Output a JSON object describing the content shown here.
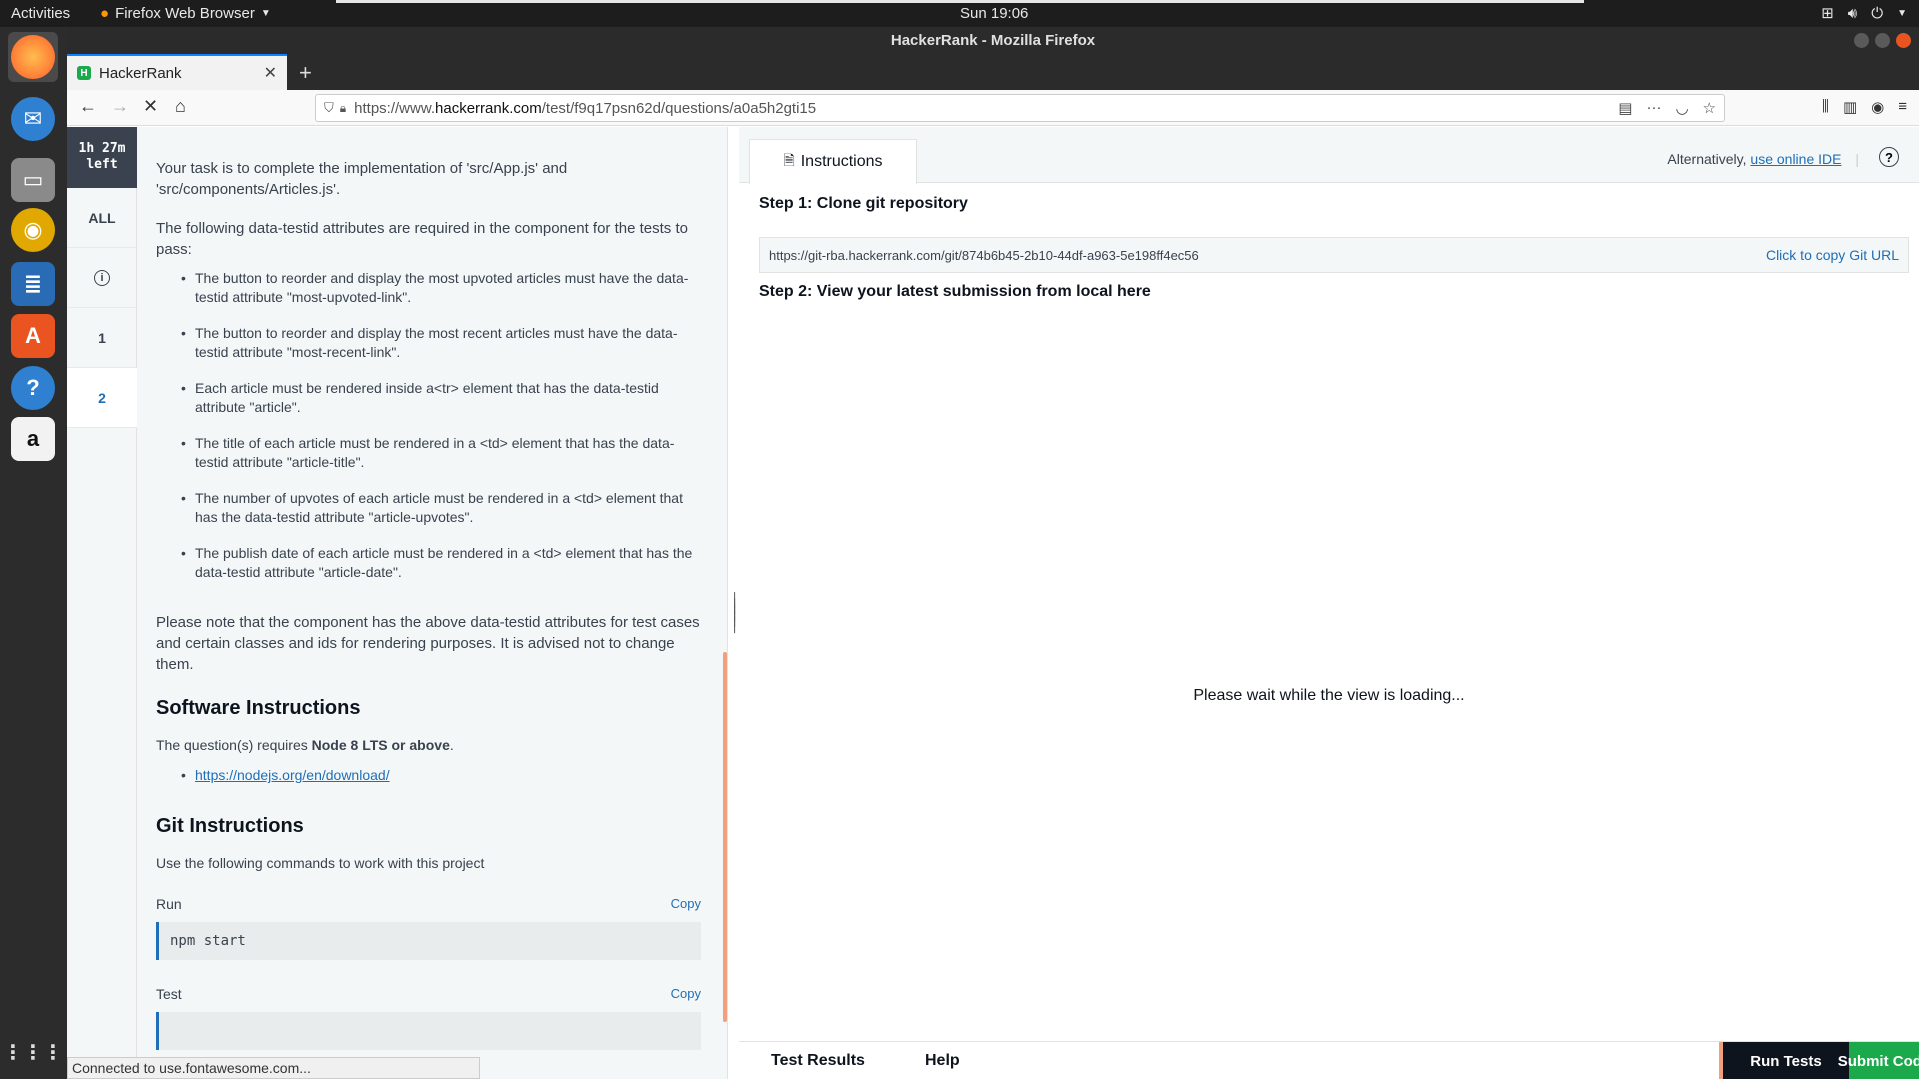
{
  "system": {
    "activities": "Activities",
    "app_menu": "Firefox Web Browser",
    "clock": "Sun 19:06"
  },
  "window": {
    "title": "HackerRank - Mozilla Firefox"
  },
  "browser": {
    "tab_title": "HackerRank",
    "url_prefix": "https://www.",
    "url_host": "hackerrank.com",
    "url_path": "/test/f9q17psn62d/questions/a0a5h2gti15",
    "status": "Connected to use.fontawesome.com..."
  },
  "qnav": {
    "timer_line1": "1h 27m",
    "timer_line2": "left",
    "all": "ALL",
    "q1": "1",
    "q2": "2"
  },
  "instructions": {
    "intro": "Your task is to complete the implementation of 'src/App.js' and 'src/components/Articles.js'.",
    "attrs_intro": "The following data-testid attributes are required in the component for the tests to pass:",
    "bullets": [
      "The button to reorder and display the most upvoted articles must have the data-testid attribute \"most-upvoted-link\".",
      "The button to reorder and display the most recent articles must have the data-testid attribute \"most-recent-link\".",
      "Each article must be rendered inside a<tr> element that has the data-testid attribute \"article\".",
      "The title of each article must be rendered in a <td> element that has the data-testid attribute \"article-title\".",
      "The number of upvotes of each article must be rendered in a <td> element that has the data-testid attribute \"article-upvotes\".",
      "The publish date of each article must be rendered in a <td> element that has the data-testid attribute \"article-date\"."
    ],
    "note": "Please note that the component has the above data-testid attributes for test cases and certain classes and ids for rendering purposes. It is advised not to change them.",
    "software_heading": "Software Instructions",
    "software_text_prefix": "The question(s) requires ",
    "software_text_bold": "Node 8 LTS or above",
    "software_text_suffix": ".",
    "node_link": "https://nodejs.org/en/download/",
    "git_heading": "Git Instructions",
    "git_text": "Use the following commands to work with this project",
    "run_label": "Run",
    "run_cmd": "npm start",
    "test_label": "Test",
    "copy_label": "Copy"
  },
  "right": {
    "tab_label": "Instructions",
    "alt_prefix": "Alternatively,",
    "alt_link": "use online IDE",
    "step1": "Step 1: Clone git repository",
    "git_url": "https://git-rba.hackerrank.com/git/874b6b45-2b10-44df-a963-5e198ff4ec56",
    "copy_git": "Click to copy Git URL",
    "step2": "Step 2: View your latest submission from local here",
    "loading": "Please wait while the view is loading...",
    "test_results": "Test Results",
    "help": "Help",
    "run_tests": "Run Tests",
    "submit_code": "Submit Code"
  }
}
